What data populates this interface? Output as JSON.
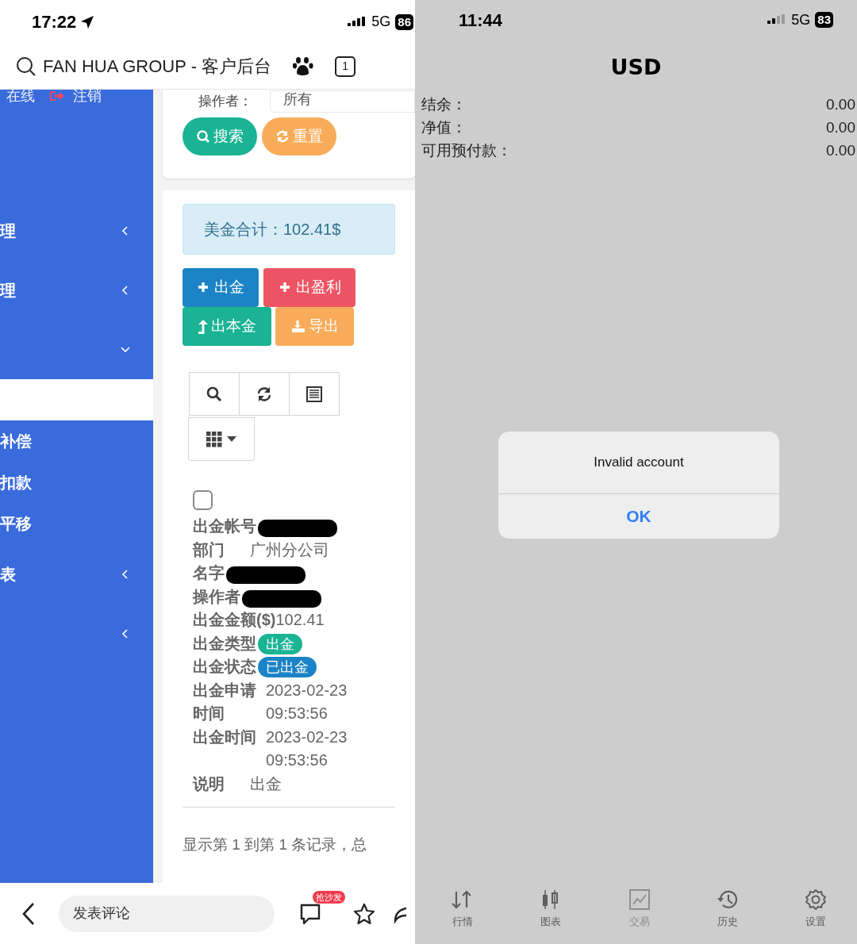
{
  "left_screen": {
    "status_bar": {
      "time": "17:22",
      "network": "5G",
      "battery": "86"
    },
    "browser_bar": {
      "title": "FAN HUA GROUP - 客户后台",
      "tab_count": "1"
    },
    "sidebar": {
      "user_status": "在线",
      "logout": "注销",
      "items": [
        {
          "kind": "menu",
          "label": "理",
          "expanded": false
        },
        {
          "kind": "menu",
          "label": "理",
          "expanded": false
        },
        {
          "kind": "menu",
          "expanded": true
        },
        {
          "kind": "band"
        },
        {
          "kind": "sub",
          "label": "补偿"
        },
        {
          "kind": "sub",
          "label": "扣款"
        },
        {
          "kind": "sub",
          "label": "平移"
        },
        {
          "kind": "menu",
          "label": "表",
          "expanded": false
        },
        {
          "kind": "menu",
          "expanded": false
        }
      ]
    },
    "filter": {
      "label": "操作者：",
      "value": "所有",
      "buttons": [
        {
          "label": "搜索",
          "color": "#1ab394"
        },
        {
          "label": "重置",
          "color": "#f8ac59"
        }
      ]
    },
    "summary": "美金合计：102.41$",
    "actions": [
      {
        "label": "出金",
        "color": "#1c84c6"
      },
      {
        "label": "出盈利",
        "color": "#ed5565"
      },
      {
        "label": "出本金",
        "color": "#1ab394"
      },
      {
        "label": "导出",
        "color": "#f8ac59"
      }
    ],
    "record": {
      "checked": false,
      "fields": [
        {
          "label": "出金帐号",
          "kind": "redacted"
        },
        {
          "label": "部门",
          "kind": "text",
          "value": "广州分公司"
        },
        {
          "label": "名字",
          "kind": "redacted"
        },
        {
          "label": "操作者",
          "kind": "redacted"
        },
        {
          "label": "出金金额($)",
          "kind": "text",
          "value": "102.41"
        },
        {
          "label": "出金类型",
          "kind": "badge",
          "value": "出金",
          "color": "#1ab394"
        },
        {
          "label": "出金状态",
          "kind": "badge",
          "value": "已出金",
          "color": "#1c84c6"
        },
        {
          "label": "出金申请时间",
          "kind": "datetime",
          "value": "2023-02-23 09:53:56"
        },
        {
          "label": "出金时间",
          "kind": "datetime",
          "value": "2023-02-23 09:53:56"
        },
        {
          "label": "说明",
          "kind": "text",
          "value": "出金"
        }
      ]
    },
    "pagination": "显示第 1 到第 1 条记录，总",
    "bottom_bar": {
      "comment_placeholder": "发表评论",
      "badge": "抢沙发"
    }
  },
  "right_screen": {
    "status_bar": {
      "time": "11:44",
      "network": "5G",
      "battery": "83"
    },
    "title": "USD",
    "rows": [
      {
        "label": "结余：",
        "value": "0.00"
      },
      {
        "label": "净值：",
        "value": "0.00"
      },
      {
        "label": "可用预付款：",
        "value": "0.00"
      }
    ],
    "dialog": {
      "message": "Invalid account",
      "button": "OK"
    },
    "tabs": [
      {
        "label": "行情",
        "disabled": false
      },
      {
        "label": "图表",
        "disabled": false
      },
      {
        "label": "交易",
        "disabled": true
      },
      {
        "label": "历史",
        "disabled": false
      },
      {
        "label": "设置",
        "disabled": false
      }
    ]
  }
}
